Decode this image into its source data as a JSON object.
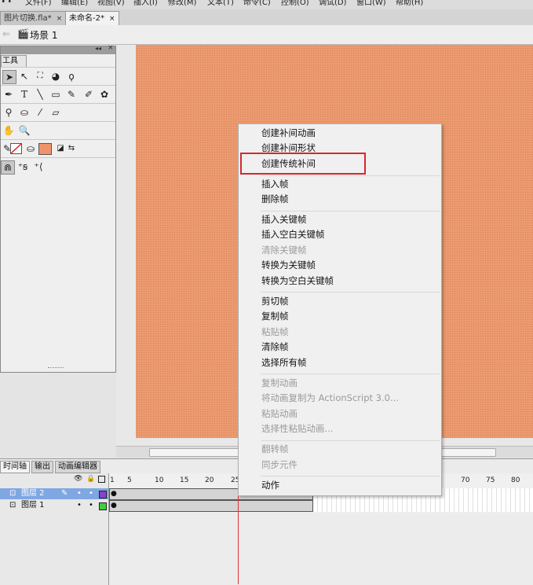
{
  "menubar": {
    "items": [
      "文件(F)",
      "编辑(E)",
      "视图(V)",
      "插入(I)",
      "修改(M)",
      "文本(T)",
      "命令(C)",
      "控制(O)",
      "调试(D)",
      "窗口(W)",
      "帮助(H)"
    ]
  },
  "doc_tabs": [
    {
      "label": "图片切换.fla*",
      "close": "×"
    },
    {
      "label": "未命名-2*",
      "close": "×"
    }
  ],
  "scene": {
    "label": "场景 1"
  },
  "tools_panel": {
    "title": "工具",
    "collapse": "◂◂",
    "close": "×"
  },
  "timeline": {
    "tabs": [
      "时间轴",
      "输出",
      "动画编辑器"
    ],
    "frame_numbers": [
      "1",
      "5",
      "10",
      "15",
      "20",
      "25",
      "70",
      "75",
      "80"
    ],
    "layers": [
      {
        "name": "图层 2",
        "selected": true,
        "color": "#8b3fd0"
      },
      {
        "name": "图层 1",
        "selected": false,
        "color": "#3ad23a"
      }
    ]
  },
  "context_menu": {
    "groups": [
      [
        {
          "label": "创建补间动画",
          "enabled": true
        },
        {
          "label": "创建补间形状",
          "enabled": true
        },
        {
          "label": "创建传统补间",
          "enabled": true
        }
      ],
      [
        {
          "label": "插入帧",
          "enabled": true
        },
        {
          "label": "删除帧",
          "enabled": true
        }
      ],
      [
        {
          "label": "插入关键帧",
          "enabled": true
        },
        {
          "label": "插入空白关键帧",
          "enabled": true
        },
        {
          "label": "清除关键帧",
          "enabled": false
        },
        {
          "label": "转换为关键帧",
          "enabled": true
        },
        {
          "label": "转换为空白关键帧",
          "enabled": true
        }
      ],
      [
        {
          "label": "剪切帧",
          "enabled": true
        },
        {
          "label": "复制帧",
          "enabled": true
        },
        {
          "label": "粘贴帧",
          "enabled": false
        },
        {
          "label": "清除帧",
          "enabled": true
        },
        {
          "label": "选择所有帧",
          "enabled": true
        }
      ],
      [
        {
          "label": "复制动画",
          "enabled": false
        },
        {
          "label": "将动画复制为 ActionScript 3.0...",
          "enabled": false
        },
        {
          "label": "粘贴动画",
          "enabled": false
        },
        {
          "label": "选择性粘贴动画...",
          "enabled": false
        }
      ],
      [
        {
          "label": "翻转帧",
          "enabled": false
        },
        {
          "label": "同步元件",
          "enabled": false
        }
      ],
      [
        {
          "label": "动作",
          "enabled": true
        }
      ]
    ],
    "highlight_color": "#d8262e"
  },
  "colors": {
    "stage": "#ec9a70",
    "fill_swatch": "#f0936a",
    "stroke_swatch": "#ffffff"
  }
}
